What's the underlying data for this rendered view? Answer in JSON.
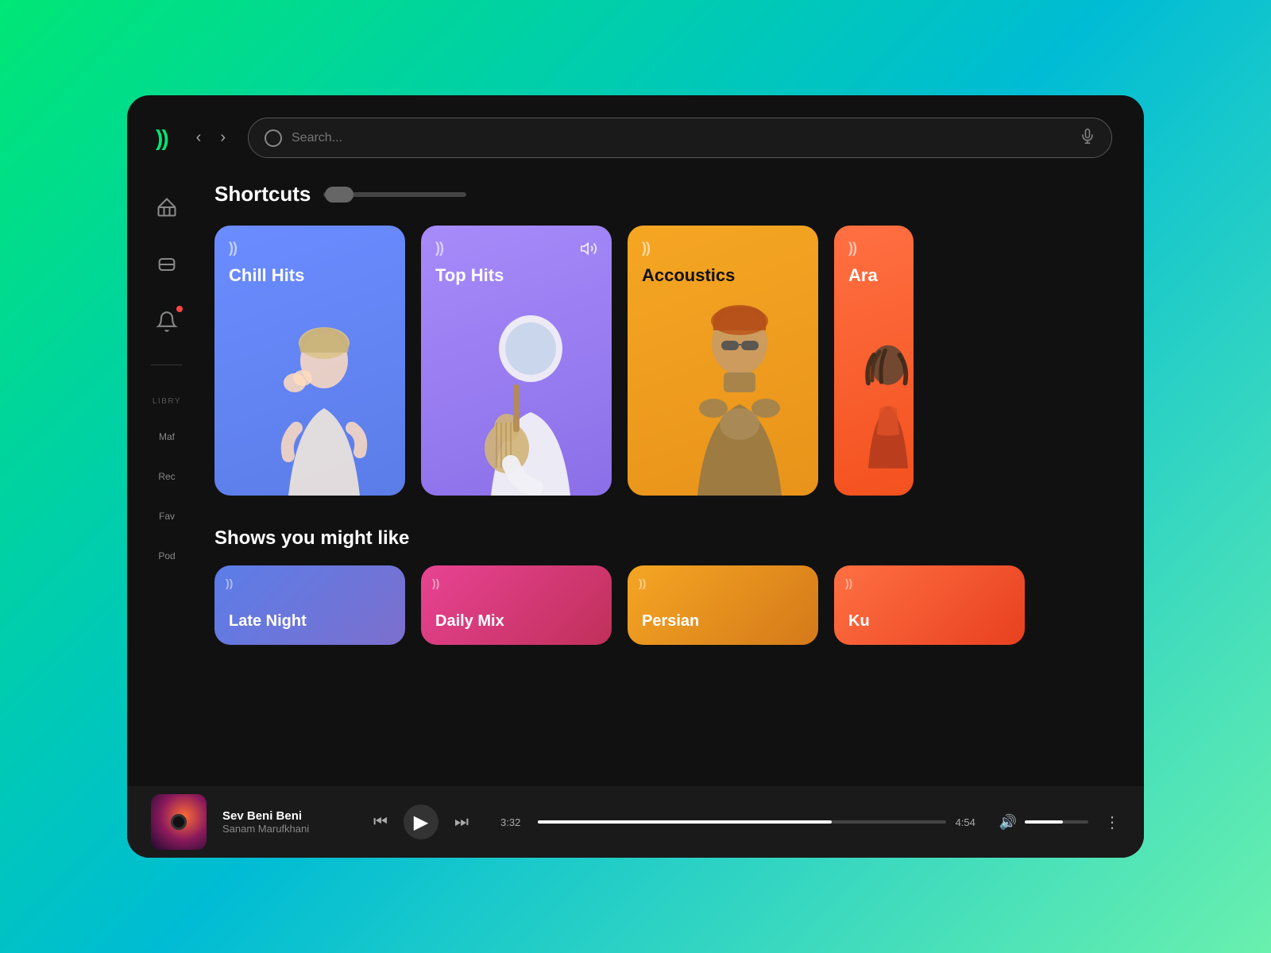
{
  "app": {
    "logo": "))",
    "window_bg": "#111111"
  },
  "header": {
    "back_label": "‹",
    "forward_label": "›",
    "search_placeholder": "Search...",
    "mic_icon": "🎤"
  },
  "sidebar": {
    "icons": [
      "home",
      "layers",
      "bell-notification"
    ],
    "section_label": "LIBRY",
    "nav_items": [
      {
        "label": "Maf",
        "key": "maf"
      },
      {
        "label": "Rec",
        "key": "rec"
      },
      {
        "label": "Fav",
        "key": "fav"
      },
      {
        "label": "Pod",
        "key": "pod"
      }
    ]
  },
  "shortcuts": {
    "section_title": "Shortcuts",
    "cards": [
      {
        "id": "chill-hits",
        "title": "Chill Hits",
        "color_class": "card-chill",
        "logo": "))",
        "has_volume": false,
        "artist_description": "blonde woman elegant pose"
      },
      {
        "id": "top-hits",
        "title": "Top Hits",
        "color_class": "card-top",
        "logo": "))",
        "has_volume": true,
        "artist_description": "astronaut with guitar"
      },
      {
        "id": "acoustics",
        "title": "Accoustics",
        "color_class": "card-acoustics",
        "logo": "))",
        "has_volume": false,
        "artist_description": "man with sunglasses"
      },
      {
        "id": "arabic",
        "title": "Ara",
        "color_class": "card-arabic",
        "logo": "))",
        "has_volume": false,
        "artist_description": "person with dreadlocks"
      }
    ]
  },
  "shows": {
    "section_title": "Shows you might like",
    "cards": [
      {
        "id": "late-night",
        "title": "Late Night",
        "color_class": "show-card-late",
        "logo": "))"
      },
      {
        "id": "daily-mix",
        "title": "Daily Mix",
        "color_class": "show-card-daily",
        "logo": "))"
      },
      {
        "id": "persian",
        "title": "Persian",
        "color_class": "show-card-persian",
        "logo": "))"
      },
      {
        "id": "k",
        "title": "Ku",
        "color_class": "show-card-k",
        "logo": "))"
      }
    ]
  },
  "player": {
    "song_title": "Sev Beni Beni",
    "artist": "Sanam Marufkhani",
    "current_time": "3:32",
    "total_time": "4:54",
    "progress_percent": 72,
    "volume_percent": 60
  }
}
